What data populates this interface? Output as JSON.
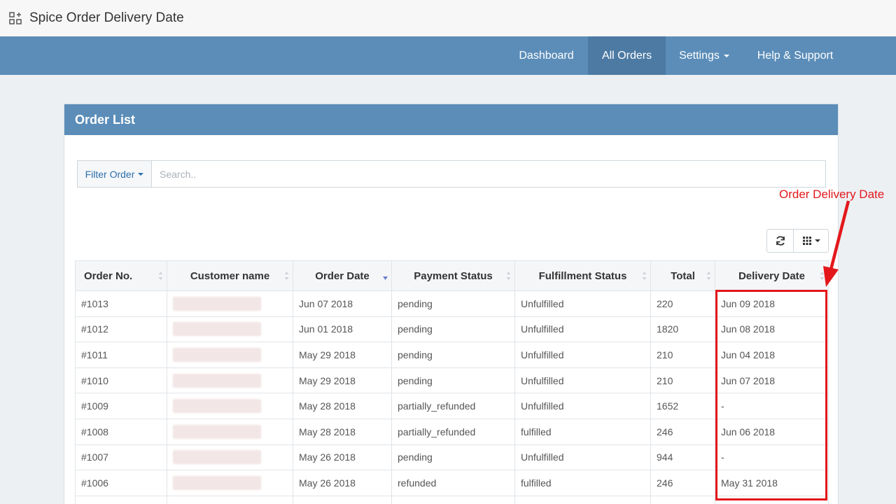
{
  "app": {
    "title": "Spice Order Delivery Date",
    "icon": "apps-grid-icon"
  },
  "nav": {
    "items": [
      {
        "label": "Dashboard"
      },
      {
        "label": "All Orders",
        "active": true
      },
      {
        "label": "Settings"
      },
      {
        "label": "Help & Support"
      }
    ]
  },
  "panel": {
    "title": "Order List"
  },
  "filter": {
    "label": "Filter Order",
    "search_placeholder": "Search..",
    "search_value": ""
  },
  "toolbar": {
    "refresh_icon": "refresh-icon",
    "columns_icon": "grid-columns-icon"
  },
  "table": {
    "columns": [
      "Order No.",
      "Customer name",
      "Order Date",
      "Payment Status",
      "Fulfillment Status",
      "Total",
      "Delivery Date"
    ],
    "sorted_column": "Order Date",
    "rows": [
      {
        "order_no": "#1013",
        "order_date": "Jun 07 2018",
        "payment_status": "pending",
        "fulfillment_status": "Unfulfilled",
        "total": "220",
        "delivery_date": "Jun 09 2018"
      },
      {
        "order_no": "#1012",
        "order_date": "Jun 01 2018",
        "payment_status": "pending",
        "fulfillment_status": "Unfulfilled",
        "total": "1820",
        "delivery_date": "Jun 08 2018"
      },
      {
        "order_no": "#1011",
        "order_date": "May 29 2018",
        "payment_status": "pending",
        "fulfillment_status": "Unfulfilled",
        "total": "210",
        "delivery_date": "Jun 04 2018"
      },
      {
        "order_no": "#1010",
        "order_date": "May 29 2018",
        "payment_status": "pending",
        "fulfillment_status": "Unfulfilled",
        "total": "210",
        "delivery_date": "Jun 07 2018"
      },
      {
        "order_no": "#1009",
        "order_date": "May 28 2018",
        "payment_status": "partially_refunded",
        "fulfillment_status": "Unfulfilled",
        "total": "1652",
        "delivery_date": "-"
      },
      {
        "order_no": "#1008",
        "order_date": "May 28 2018",
        "payment_status": "partially_refunded",
        "fulfillment_status": "fulfilled",
        "total": "246",
        "delivery_date": "Jun 06 2018"
      },
      {
        "order_no": "#1007",
        "order_date": "May 26 2018",
        "payment_status": "pending",
        "fulfillment_status": "Unfulfilled",
        "total": "944",
        "delivery_date": "-"
      },
      {
        "order_no": "#1006",
        "order_date": "May 26 2018",
        "payment_status": "refunded",
        "fulfillment_status": "fulfilled",
        "total": "246",
        "delivery_date": "May 31 2018"
      }
    ]
  },
  "annotation": {
    "label": "Order Delivery Date",
    "color": "#e3171b"
  },
  "colors": {
    "nav_bg": "#5b8db8",
    "nav_active": "#4c7aa3",
    "page_bg": "#ecf0f3"
  }
}
